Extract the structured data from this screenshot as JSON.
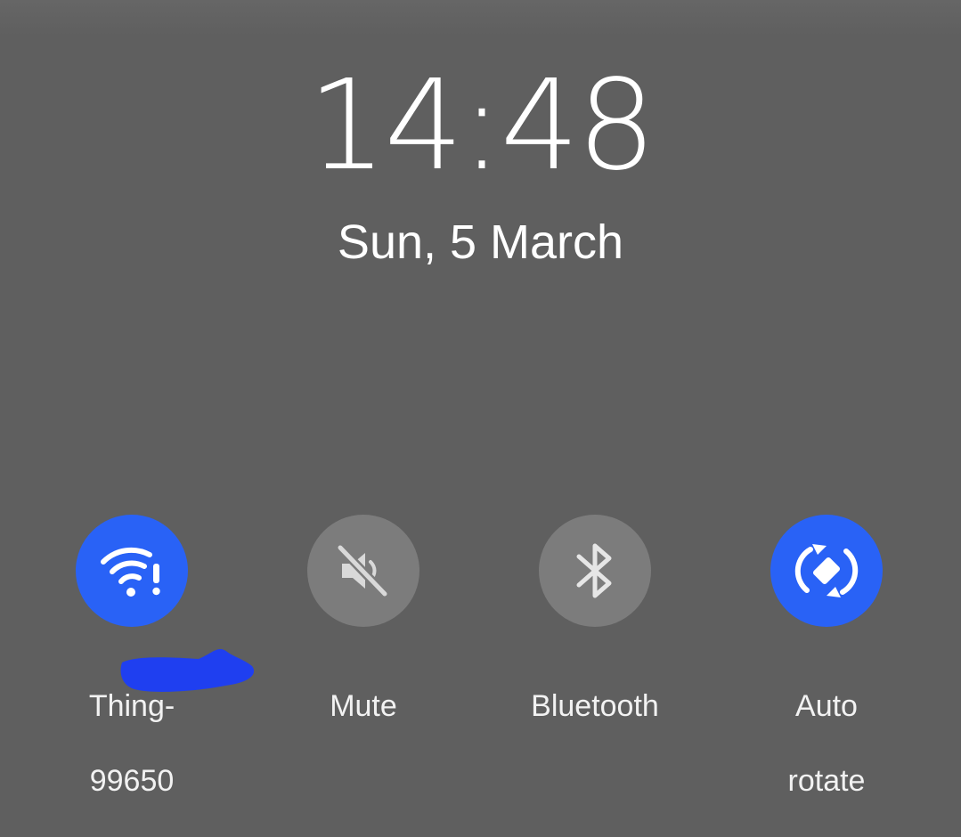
{
  "lockscreen": {
    "time": "14:48",
    "date": "Sun, 5 March"
  },
  "quick_settings": {
    "tiles": [
      {
        "id": "wifi",
        "label_line1": "Thing-",
        "label_line2": "99650",
        "state": "on",
        "icon": "wifi-no-internet-icon"
      },
      {
        "id": "mute",
        "label_line1": "Mute",
        "label_line2": "",
        "state": "off",
        "icon": "mute-icon"
      },
      {
        "id": "bluetooth",
        "label_line1": "Bluetooth",
        "label_line2": "",
        "state": "off",
        "icon": "bluetooth-icon"
      },
      {
        "id": "auto-rotate",
        "label_line1": "Auto",
        "label_line2": "rotate",
        "state": "on",
        "icon": "auto-rotate-icon"
      }
    ]
  },
  "colors": {
    "background": "#5f5f5f",
    "tile_active": "#2962f6",
    "tile_inactive": "#7c7c7c",
    "redaction": "#1f3ff0"
  }
}
